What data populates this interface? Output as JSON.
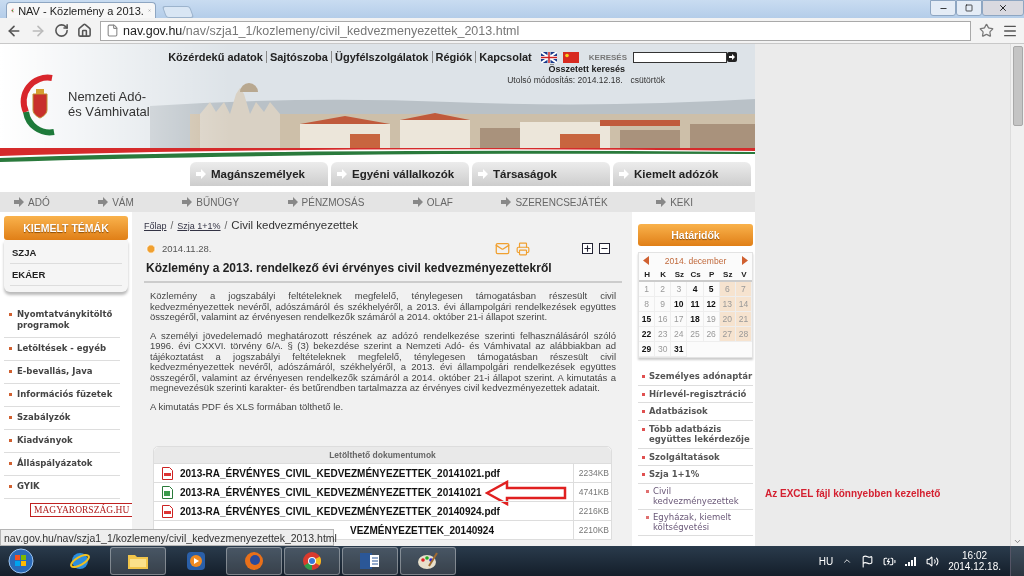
{
  "browser": {
    "tab": {
      "title": "NAV - Közlemény a 2013."
    },
    "address": {
      "host": "nav.gov.hu",
      "path": "/nav/szja1_1/kozlemeny/civil_kedvezmenyezettek_2013.html"
    }
  },
  "header": {
    "logo_lines": [
      "Nemzeti Adó-",
      "és Vámhivatal"
    ],
    "top_links": [
      "Közérdekű adatok",
      "Sajtószoba",
      "Ügyfélszolgálatok",
      "Régiók",
      "Kapcsolat"
    ],
    "search_label": "KERESÉS",
    "advanced_search": "Összetett keresés",
    "last_modified": "Utolsó módosítás: 2014.12.18.",
    "weekday": "csütörtök"
  },
  "main_tabs": [
    "Magánszemélyek",
    "Egyéni vállalkozók",
    "Társaságok",
    "Kiemelt adózók"
  ],
  "nav": [
    "ADÓ",
    "VÁM",
    "BŰNÜGY",
    "PÉNZMOSÁS",
    "OLAF",
    "SZERENCSEJÁTÉK",
    "KEKI"
  ],
  "left_sidebar": {
    "title": "KIEMELT TÉMÁK",
    "featured": [
      "SZJA",
      "EKÁER"
    ],
    "links": [
      "Nyomtatványkitöltő programok",
      "Letöltések - egyéb",
      "E-bevallás, Java",
      "Információs füzetek",
      "Szabályzók",
      "Kiadványok",
      "Álláspályázatok",
      "GYIK"
    ],
    "banner": "MAGYARORSZÁG.HU"
  },
  "article": {
    "breadcrumb_separator": "/",
    "breadcrumb": [
      {
        "label": "Főlap",
        "link": true
      },
      {
        "label": "Szja 1+1%",
        "link": true
      },
      {
        "label": "Civil kedvezményezettek",
        "link": false
      }
    ],
    "date": "2014.11.28.",
    "title": "Közlemény a 2013. rendelkező évi érvényes civil kedvezményezettekről",
    "paragraphs": [
      "Közlemény a jogszabályi feltételeknek megfelelő, ténylegesen támogatásban részesült civil kedvezményezettek nevéről, adószámáról és székhelyéről, a 2013. évi állampolgári rendelkezések együttes összegéről, valamint az érvényesen rendelkezők számáról a 2014. október 21-i állapot szerint.",
      "A személyi jövedelemadó meghatározott részének az adózó rendelkezése szerinti felhasználásáról szóló 1996. évi CXXVI. törvény 6/A. § (3) bekezdése szerint a Nemzeti Adó- és Vámhivatal az alábbiakban ad tájékoztatást a jogszabályi feltételeknek megfelelő, ténylegesen támogatásban részesült civil kedvezményezettek nevéről, adószámáról, székhelyéről, a 2013. évi állampolgári rendelkezések együttes összegéről, valamint az érvényesen rendelkezők számáról a 2014. október 21-i állapot szerint. A kimutatás a megnevezésük szerinti karakter- és betűrendben tartalmazza az érvényes civil kedvezményezettek adatait.",
      "A kimutatás PDF és XLS formában tölthető le."
    ],
    "downloads": {
      "title": "Letölthető dokumentumok",
      "rows": [
        {
          "kind": "pdf",
          "name": "2013-RA_ÉRVÉNYES_CIVIL_KEDVEZMÉNYEZETTEK_20141021.pdf",
          "size": "2234KB",
          "highlighted": false,
          "covered": false
        },
        {
          "kind": "xls",
          "name": "2013-RA_ÉRVÉNYES_CIVIL_KEDVEZMÉNYEZETTEK_20141021",
          "size": "4741KB",
          "highlighted": true,
          "covered": false
        },
        {
          "kind": "pdf",
          "name": "2013-RA_ÉRVÉNYES_CIVIL_KEDVEZMÉNYEZETTEK_20140924.pdf",
          "size": "2216KB",
          "highlighted": false,
          "covered": false
        },
        {
          "name": "VEZMÉNYEZETTEK_20140924",
          "size": "2210KB",
          "highlighted": false,
          "covered": true
        }
      ]
    }
  },
  "right_sidebar": {
    "title": "Határidők",
    "calendar": {
      "month": "2014. december",
      "weekdays": [
        "H",
        "K",
        "Sz",
        "Cs",
        "P",
        "Sz",
        "V"
      ],
      "weeks": [
        [
          {
            "day": "1",
            "deadline": false
          },
          {
            "day": "2",
            "deadline": false
          },
          {
            "day": "3",
            "deadline": false
          },
          {
            "day": "4",
            "deadline": true
          },
          {
            "day": "5",
            "deadline": true
          },
          {
            "day": "6",
            "deadline": false
          },
          {
            "day": "7",
            "deadline": false
          }
        ],
        [
          {
            "day": "8",
            "deadline": false
          },
          {
            "day": "9",
            "deadline": false
          },
          {
            "day": "10",
            "deadline": true
          },
          {
            "day": "11",
            "deadline": true
          },
          {
            "day": "12",
            "deadline": true
          },
          {
            "day": "13",
            "deadline": false
          },
          {
            "day": "14",
            "deadline": false
          }
        ],
        [
          {
            "day": "15",
            "deadline": true
          },
          {
            "day": "16",
            "deadline": false
          },
          {
            "day": "17",
            "deadline": false
          },
          {
            "day": "18",
            "deadline": true
          },
          {
            "day": "19",
            "deadline": false
          },
          {
            "day": "20",
            "deadline": false
          },
          {
            "day": "21",
            "deadline": false
          }
        ],
        [
          {
            "day": "22",
            "deadline": true
          },
          {
            "day": "23",
            "deadline": false
          },
          {
            "day": "24",
            "deadline": false
          },
          {
            "day": "25",
            "deadline": false
          },
          {
            "day": "26",
            "deadline": false
          },
          {
            "day": "27",
            "deadline": false
          },
          {
            "day": "28",
            "deadline": false
          }
        ],
        [
          {
            "day": "29",
            "deadline": true
          },
          {
            "day": "30",
            "deadline": false
          },
          {
            "day": "31",
            "deadline": true
          }
        ]
      ]
    },
    "links": [
      {
        "label": "Személyes adónaptár"
      },
      {
        "label": "Hírlevél-regisztráció"
      },
      {
        "label": "Adatbázisok"
      },
      {
        "label": "Több adatbázis együttes lekérdezője"
      },
      {
        "label": "Szolgáltatások"
      },
      {
        "label": "Szja 1+1%",
        "children": [
          {
            "label": "Civil kedvezményezettek"
          },
          {
            "label": "Egyházak, kiemelt költségvetési"
          }
        ]
      }
    ]
  },
  "annotation": "Az EXCEL fájl könnyebben kezelhető",
  "status_bar": "nav.gov.hu/nav/szja1_1/kozlemeny/civil_kedvezmenyezettek_2013.html",
  "taskbar": {
    "apps": [
      {
        "kind": "ie",
        "open": false
      },
      {
        "kind": "folder",
        "open": true
      },
      {
        "kind": "media",
        "open": false
      },
      {
        "kind": "firefox",
        "open": true
      },
      {
        "kind": "chrome",
        "open": true
      },
      {
        "kind": "word",
        "open": true
      },
      {
        "kind": "paint",
        "open": true
      }
    ],
    "language": "HU",
    "time": "16:02",
    "date": "2014.12.18."
  }
}
